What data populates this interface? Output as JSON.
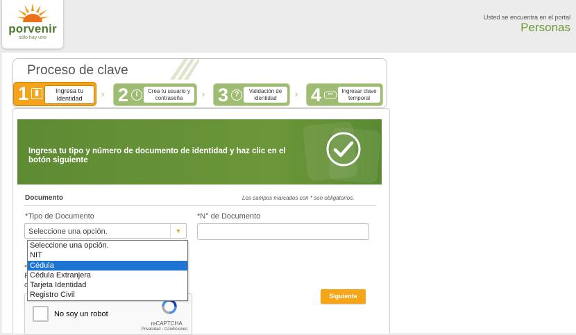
{
  "brand": {
    "name": "porvenir",
    "tagline": "sólo hay uno"
  },
  "portal": {
    "label": "Usted se encuentra en el portal",
    "name": "Personas"
  },
  "process": {
    "title": "Proceso de clave",
    "steps": [
      {
        "number": "1",
        "label": "Ingresa tu Identidad",
        "icon": "id-card-icon",
        "state": "active"
      },
      {
        "number": "2",
        "label": "Crea tu usuario y contraseña",
        "icon": "info-icon",
        "state": "pending"
      },
      {
        "number": "3",
        "label": "Validación de identidad",
        "icon": "question-icon",
        "state": "pending"
      },
      {
        "number": "4",
        "label": "Ingresar clave temporal",
        "icon": "password-icon",
        "state": "pending"
      }
    ]
  },
  "banner": {
    "text": "Ingresa tu tipo y número de documento de identidad y haz clic en el botón",
    "text_bold": "siguiente",
    "icon": "check-circle-icon"
  },
  "form": {
    "section_title": "Documento",
    "required_note": "Los campos marcados con * son obligatorios.",
    "tipo_label": "*Tipo de Documento",
    "tipo_value": "Seleccione una opción.",
    "numero_label": "*N° de Documento",
    "numero_value": "",
    "options": [
      "Seleccione una opción.",
      "NIT",
      "Cédula",
      "Cédula Extranjera",
      "Tarjeta Identidad",
      "Registro Civil"
    ],
    "highlighted_option": "Cédula",
    "partial_text": [
      "*",
      "P",
      "c"
    ],
    "submit_label": "Siguiente"
  },
  "recaptcha": {
    "label": "No soy un robot",
    "brand": "reCAPTCHA",
    "links": "Privacidad - Condiciones"
  },
  "colors": {
    "green": "#6b9639",
    "orange": "#f5a515",
    "highlight": "#1e74d2"
  }
}
